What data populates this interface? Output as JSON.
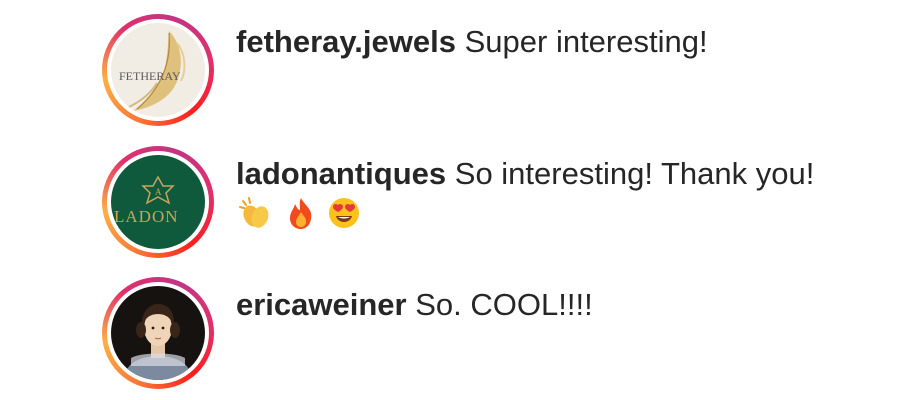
{
  "comments": [
    {
      "username": "fetheray.jewels",
      "text": "Super interesting!",
      "avatar_logo": "FETHERAY"
    },
    {
      "username": "ladonantiques",
      "text": "So interesting! Thank you!",
      "emojis": [
        "clapping-hands",
        "fire",
        "heart-eyes"
      ],
      "avatar_logo": "LADON"
    },
    {
      "username": "ericaweiner",
      "text": "So. COOL!!!!"
    }
  ],
  "colors": {
    "username": "#262626",
    "text": "#262626",
    "ring_gradient": [
      "#f77737",
      "#fcaf45",
      "#e1306c",
      "#c13584"
    ],
    "ladon_green": "#0f5a3c",
    "fetheray_bg": "#f1ece4"
  }
}
